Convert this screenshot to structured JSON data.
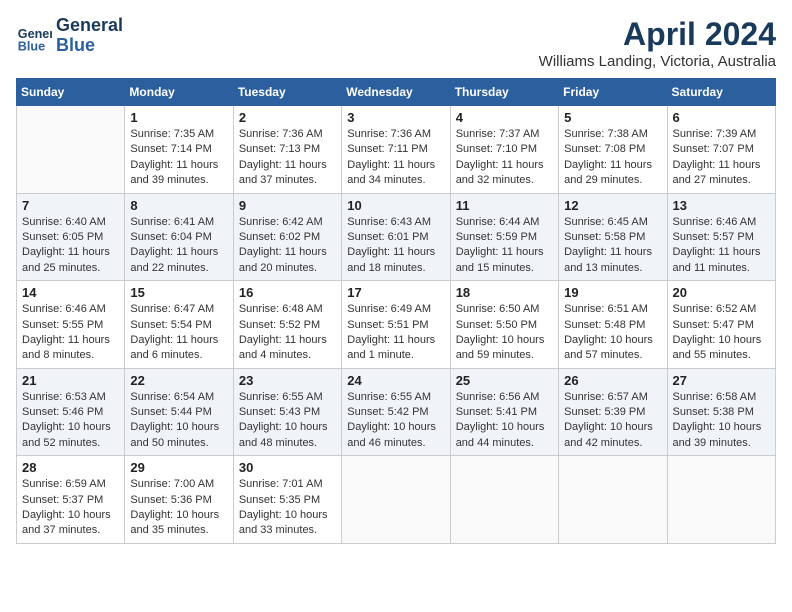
{
  "header": {
    "logo_line1": "General",
    "logo_line2": "Blue",
    "month": "April 2024",
    "location": "Williams Landing, Victoria, Australia"
  },
  "weekdays": [
    "Sunday",
    "Monday",
    "Tuesday",
    "Wednesday",
    "Thursday",
    "Friday",
    "Saturday"
  ],
  "weeks": [
    [
      {
        "day": "",
        "info": ""
      },
      {
        "day": "1",
        "info": "Sunrise: 7:35 AM\nSunset: 7:14 PM\nDaylight: 11 hours\nand 39 minutes."
      },
      {
        "day": "2",
        "info": "Sunrise: 7:36 AM\nSunset: 7:13 PM\nDaylight: 11 hours\nand 37 minutes."
      },
      {
        "day": "3",
        "info": "Sunrise: 7:36 AM\nSunset: 7:11 PM\nDaylight: 11 hours\nand 34 minutes."
      },
      {
        "day": "4",
        "info": "Sunrise: 7:37 AM\nSunset: 7:10 PM\nDaylight: 11 hours\nand 32 minutes."
      },
      {
        "day": "5",
        "info": "Sunrise: 7:38 AM\nSunset: 7:08 PM\nDaylight: 11 hours\nand 29 minutes."
      },
      {
        "day": "6",
        "info": "Sunrise: 7:39 AM\nSunset: 7:07 PM\nDaylight: 11 hours\nand 27 minutes."
      }
    ],
    [
      {
        "day": "7",
        "info": "Sunrise: 6:40 AM\nSunset: 6:05 PM\nDaylight: 11 hours\nand 25 minutes."
      },
      {
        "day": "8",
        "info": "Sunrise: 6:41 AM\nSunset: 6:04 PM\nDaylight: 11 hours\nand 22 minutes."
      },
      {
        "day": "9",
        "info": "Sunrise: 6:42 AM\nSunset: 6:02 PM\nDaylight: 11 hours\nand 20 minutes."
      },
      {
        "day": "10",
        "info": "Sunrise: 6:43 AM\nSunset: 6:01 PM\nDaylight: 11 hours\nand 18 minutes."
      },
      {
        "day": "11",
        "info": "Sunrise: 6:44 AM\nSunset: 5:59 PM\nDaylight: 11 hours\nand 15 minutes."
      },
      {
        "day": "12",
        "info": "Sunrise: 6:45 AM\nSunset: 5:58 PM\nDaylight: 11 hours\nand 13 minutes."
      },
      {
        "day": "13",
        "info": "Sunrise: 6:46 AM\nSunset: 5:57 PM\nDaylight: 11 hours\nand 11 minutes."
      }
    ],
    [
      {
        "day": "14",
        "info": "Sunrise: 6:46 AM\nSunset: 5:55 PM\nDaylight: 11 hours\nand 8 minutes."
      },
      {
        "day": "15",
        "info": "Sunrise: 6:47 AM\nSunset: 5:54 PM\nDaylight: 11 hours\nand 6 minutes."
      },
      {
        "day": "16",
        "info": "Sunrise: 6:48 AM\nSunset: 5:52 PM\nDaylight: 11 hours\nand 4 minutes."
      },
      {
        "day": "17",
        "info": "Sunrise: 6:49 AM\nSunset: 5:51 PM\nDaylight: 11 hours\nand 1 minute."
      },
      {
        "day": "18",
        "info": "Sunrise: 6:50 AM\nSunset: 5:50 PM\nDaylight: 10 hours\nand 59 minutes."
      },
      {
        "day": "19",
        "info": "Sunrise: 6:51 AM\nSunset: 5:48 PM\nDaylight: 10 hours\nand 57 minutes."
      },
      {
        "day": "20",
        "info": "Sunrise: 6:52 AM\nSunset: 5:47 PM\nDaylight: 10 hours\nand 55 minutes."
      }
    ],
    [
      {
        "day": "21",
        "info": "Sunrise: 6:53 AM\nSunset: 5:46 PM\nDaylight: 10 hours\nand 52 minutes."
      },
      {
        "day": "22",
        "info": "Sunrise: 6:54 AM\nSunset: 5:44 PM\nDaylight: 10 hours\nand 50 minutes."
      },
      {
        "day": "23",
        "info": "Sunrise: 6:55 AM\nSunset: 5:43 PM\nDaylight: 10 hours\nand 48 minutes."
      },
      {
        "day": "24",
        "info": "Sunrise: 6:55 AM\nSunset: 5:42 PM\nDaylight: 10 hours\nand 46 minutes."
      },
      {
        "day": "25",
        "info": "Sunrise: 6:56 AM\nSunset: 5:41 PM\nDaylight: 10 hours\nand 44 minutes."
      },
      {
        "day": "26",
        "info": "Sunrise: 6:57 AM\nSunset: 5:39 PM\nDaylight: 10 hours\nand 42 minutes."
      },
      {
        "day": "27",
        "info": "Sunrise: 6:58 AM\nSunset: 5:38 PM\nDaylight: 10 hours\nand 39 minutes."
      }
    ],
    [
      {
        "day": "28",
        "info": "Sunrise: 6:59 AM\nSunset: 5:37 PM\nDaylight: 10 hours\nand 37 minutes."
      },
      {
        "day": "29",
        "info": "Sunrise: 7:00 AM\nSunset: 5:36 PM\nDaylight: 10 hours\nand 35 minutes."
      },
      {
        "day": "30",
        "info": "Sunrise: 7:01 AM\nSunset: 5:35 PM\nDaylight: 10 hours\nand 33 minutes."
      },
      {
        "day": "",
        "info": ""
      },
      {
        "day": "",
        "info": ""
      },
      {
        "day": "",
        "info": ""
      },
      {
        "day": "",
        "info": ""
      }
    ]
  ]
}
